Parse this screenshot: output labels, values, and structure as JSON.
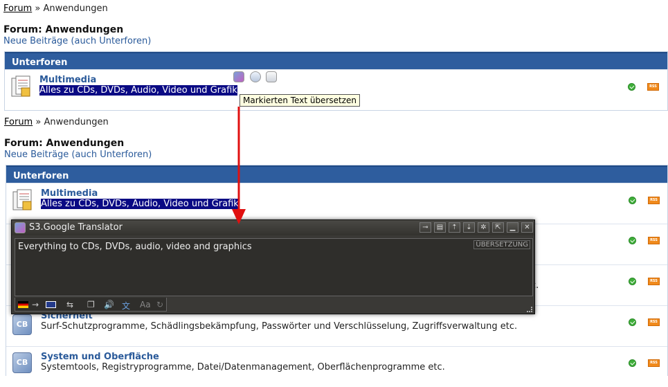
{
  "breadcrumb": {
    "forum_link": "Forum",
    "separator": "»",
    "current": "Anwendungen"
  },
  "page_title": "Forum: Anwendungen",
  "new_posts_link": "Neue Beiträge (auch Unterforen)",
  "section_header": "Unterforen",
  "forums": [
    {
      "name": "Multimedia",
      "description": "Alles zu CDs, DVDs, Audio, Video und Grafik"
    },
    {
      "name": "Sicherheit",
      "description": "Surf-Schutzprogramme, Schädlingsbekämpfung, Passwörter und Verschlüsselung, Zugriffsverwaltung etc."
    },
    {
      "name": "System und Oberfläche",
      "description": "Systemtools, Registryprogramme, Datei/Datenmanagement, Oberflächenprogramme etc."
    }
  ],
  "partial_text": "c.",
  "tooltip": "Markierten Text übersetzen",
  "translator": {
    "title": "S3.Google Translator",
    "translation": "Everything to CDs, DVDs, audio, video and graphics",
    "badge": "ÜBERSETZUNG",
    "arrow": "→"
  },
  "rss_label": "RSS",
  "colors": {
    "header_bar": "#2e5d9e",
    "link": "#2a5a9a",
    "selection": "#0a0a84",
    "arrow": "#e01010",
    "translator_bg": "#3a3936"
  }
}
